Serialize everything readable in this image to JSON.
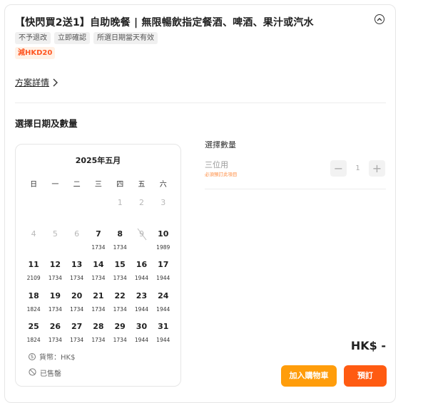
{
  "package": {
    "title": "【快閃買2送1】自助晚餐 | 無限暢飲指定餐酒、啤酒、果汁或汽水",
    "tags": [
      "不予退改",
      "立即確認",
      "所選日期當天有效"
    ],
    "promo": "減HKD20",
    "details_link": "方案詳情"
  },
  "date_section": {
    "title": "選擇日期及數量"
  },
  "calendar": {
    "month_title": "2025年五月",
    "weekdays": [
      "日",
      "一",
      "二",
      "三",
      "四",
      "五",
      "六"
    ],
    "days": [
      {
        "num": "",
        "price": "",
        "state": "empty"
      },
      {
        "num": "",
        "price": "",
        "state": "empty"
      },
      {
        "num": "",
        "price": "",
        "state": "empty"
      },
      {
        "num": "",
        "price": "",
        "state": "empty"
      },
      {
        "num": "1",
        "price": "",
        "state": "muted"
      },
      {
        "num": "2",
        "price": "",
        "state": "muted"
      },
      {
        "num": "3",
        "price": "",
        "state": "muted"
      },
      {
        "num": "4",
        "price": "",
        "state": "muted"
      },
      {
        "num": "5",
        "price": "",
        "state": "muted"
      },
      {
        "num": "6",
        "price": "",
        "state": "muted"
      },
      {
        "num": "7",
        "price": "1734",
        "state": "available"
      },
      {
        "num": "8",
        "price": "1734",
        "state": "available"
      },
      {
        "num": "9",
        "price": "",
        "state": "soldout"
      },
      {
        "num": "10",
        "price": "1989",
        "state": "available"
      },
      {
        "num": "11",
        "price": "2109",
        "state": "available"
      },
      {
        "num": "12",
        "price": "1734",
        "state": "available"
      },
      {
        "num": "13",
        "price": "1734",
        "state": "available"
      },
      {
        "num": "14",
        "price": "1734",
        "state": "available"
      },
      {
        "num": "15",
        "price": "1734",
        "state": "available"
      },
      {
        "num": "16",
        "price": "1944",
        "state": "available"
      },
      {
        "num": "17",
        "price": "1944",
        "state": "available"
      },
      {
        "num": "18",
        "price": "1824",
        "state": "available"
      },
      {
        "num": "19",
        "price": "1734",
        "state": "available"
      },
      {
        "num": "20",
        "price": "1734",
        "state": "available"
      },
      {
        "num": "21",
        "price": "1734",
        "state": "available"
      },
      {
        "num": "22",
        "price": "1734",
        "state": "available"
      },
      {
        "num": "23",
        "price": "1944",
        "state": "available"
      },
      {
        "num": "24",
        "price": "1944",
        "state": "available"
      },
      {
        "num": "25",
        "price": "1824",
        "state": "available"
      },
      {
        "num": "26",
        "price": "1734",
        "state": "available"
      },
      {
        "num": "27",
        "price": "1734",
        "state": "available"
      },
      {
        "num": "28",
        "price": "1734",
        "state": "available"
      },
      {
        "num": "29",
        "price": "1734",
        "state": "available"
      },
      {
        "num": "30",
        "price": "1944",
        "state": "available"
      },
      {
        "num": "31",
        "price": "1944",
        "state": "available"
      }
    ],
    "currency_note": "貨幣：HK$",
    "soldout_note": "已售罄"
  },
  "quantity": {
    "label": "選擇數量",
    "row_name": "三位用",
    "required_note": "必須預訂此項目",
    "minus": "−",
    "value": "1",
    "plus": "+"
  },
  "footer": {
    "total": "HK$ -",
    "add_to_cart": "加入購物車",
    "book": "預訂"
  },
  "colors": {
    "accent_orange": "#ff5b12",
    "cart_orange": "#ff9d0b",
    "promo_text": "#ff5722"
  },
  "icons": {
    "collapse": "chevron-up-circle-icon",
    "details": "chevron-right-icon",
    "currency": "dollar-circle-icon",
    "soldout": "no-entry-icon"
  }
}
